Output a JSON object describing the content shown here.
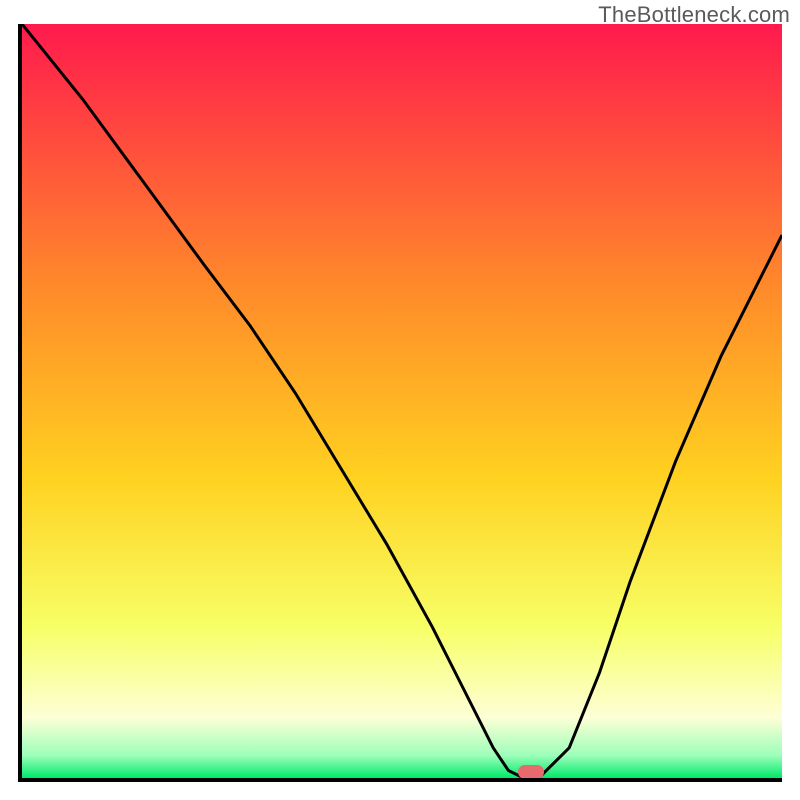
{
  "watermark": "TheBottleneck.com",
  "colors": {
    "top": "#ff1a4d",
    "mid_upper": "#ff8a2a",
    "mid": "#ffd120",
    "mid_lower": "#f7ff66",
    "pale": "#fdffd6",
    "green": "#00e96b",
    "marker": "#e76a6f",
    "curve": "#000000"
  },
  "chart_data": {
    "type": "line",
    "title": "",
    "xlabel": "",
    "ylabel": "",
    "xlim": [
      0,
      100
    ],
    "ylim": [
      0,
      100
    ],
    "x": [
      0,
      8,
      16,
      24,
      30,
      36,
      42,
      48,
      54,
      58,
      62,
      64,
      66,
      68,
      72,
      76,
      80,
      86,
      92,
      100
    ],
    "values": [
      100,
      90,
      79,
      68,
      60,
      51,
      41,
      31,
      20,
      12,
      4,
      1,
      0,
      0,
      4,
      14,
      26,
      42,
      56,
      72
    ],
    "marker": {
      "x": 67,
      "y": 0
    },
    "gradient_stops": [
      {
        "pos": 0.0,
        "color": "#ff1a4d"
      },
      {
        "pos": 0.35,
        "color": "#ff8a2a"
      },
      {
        "pos": 0.6,
        "color": "#ffd120"
      },
      {
        "pos": 0.8,
        "color": "#f7ff66"
      },
      {
        "pos": 0.92,
        "color": "#fdffd6"
      },
      {
        "pos": 0.97,
        "color": "#9dffba"
      },
      {
        "pos": 1.0,
        "color": "#00e96b"
      }
    ]
  }
}
